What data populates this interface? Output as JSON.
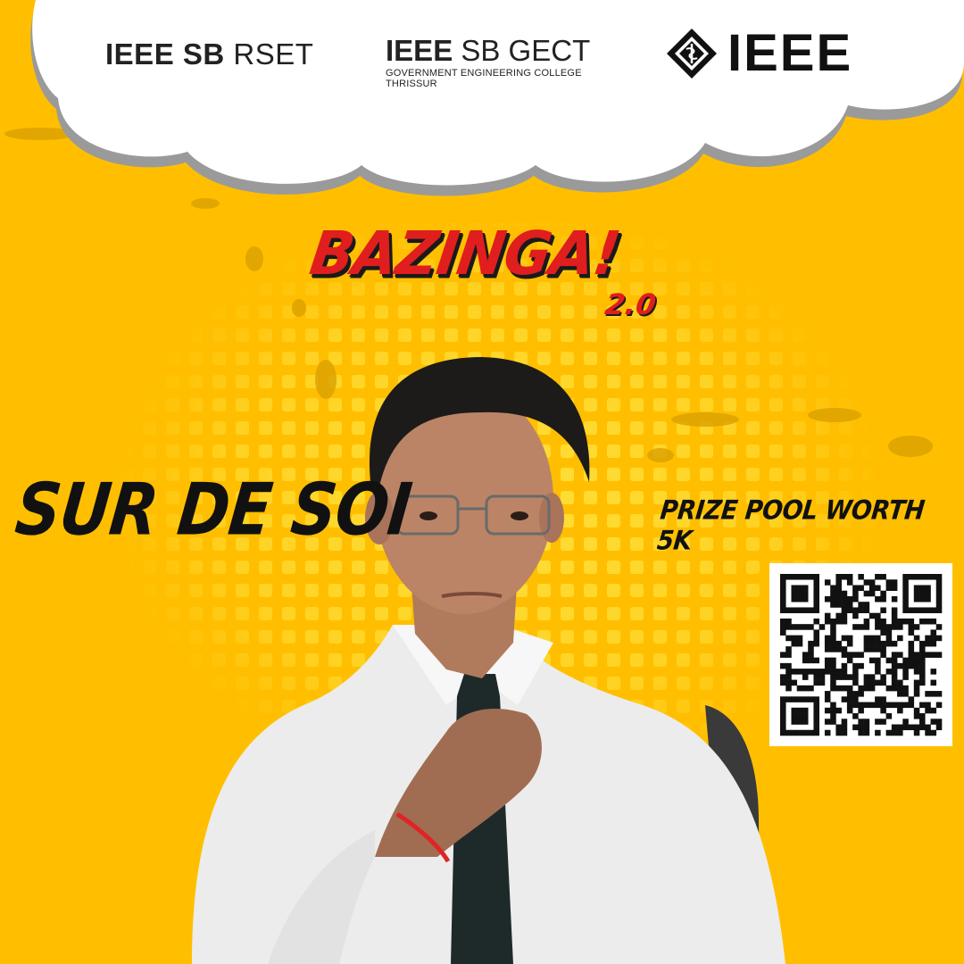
{
  "logos": {
    "rset": {
      "bold": "IEEE SB",
      "light": " RSET"
    },
    "gect": {
      "bold": "IEEE",
      "light": " SB GECT",
      "sub_line1": "GOVERNMENT ENGINEERING COLLEGE",
      "sub_line2": "THRISSUR"
    },
    "ieee": {
      "word": "IEEE",
      "icon": "ieee-diamond-icon"
    }
  },
  "title": "BAZINGA!",
  "version": "2.0",
  "event_name": "SUR DE SOI",
  "prize_text": "PRIZE POOL WORTH 5K",
  "qr": {
    "icon": "qr-code"
  },
  "colors": {
    "background": "#ffbf00",
    "title_red": "#e01e1e",
    "text_dark": "#111111",
    "cloud": "#ffffff",
    "dots": "#ffdf3a"
  }
}
